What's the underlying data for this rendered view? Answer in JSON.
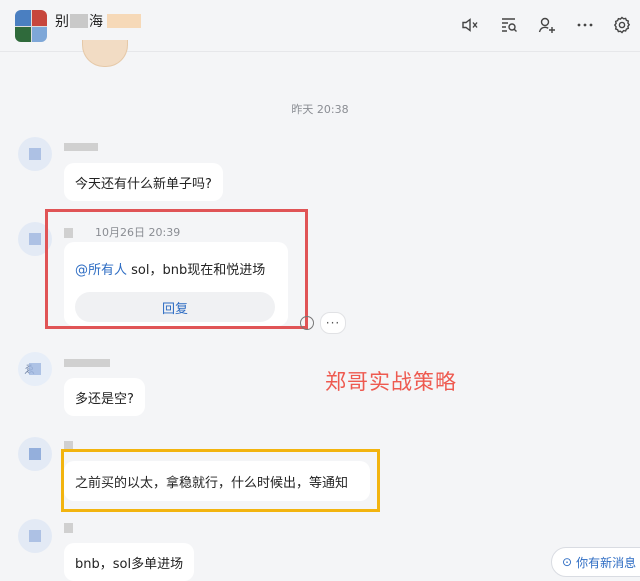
{
  "header": {
    "title_start": "别",
    "title_end": "海"
  },
  "timeline": {
    "separator_time": "昨天 20:38"
  },
  "messages": [
    {
      "text": "今天还有什么新单子吗?"
    },
    {
      "sender_time": "10月26日 20:39",
      "mention": "@所有人",
      "text": " sol，bnb现在和悦进场",
      "reply_label": "回复"
    },
    {
      "avatar_letter": "ゑ",
      "text": "多还是空?"
    },
    {
      "text": "之前买的以太，拿稳就行，什么时候出，等通知"
    },
    {
      "text": "bnb，sol多单进场"
    }
  ],
  "annotations": {
    "overlay_text": "郑哥实战策略"
  },
  "new_message_button": {
    "label": "你有新消息"
  },
  "colors": {
    "accent": "#2d6cc3",
    "highlight_red": "#e05456",
    "highlight_yellow": "#f2b40f",
    "overlay_text": "#ee5a50"
  },
  "icons": [
    "speaker-icon",
    "search-history-icon",
    "add-member-icon",
    "more-icon",
    "settings-icon"
  ]
}
